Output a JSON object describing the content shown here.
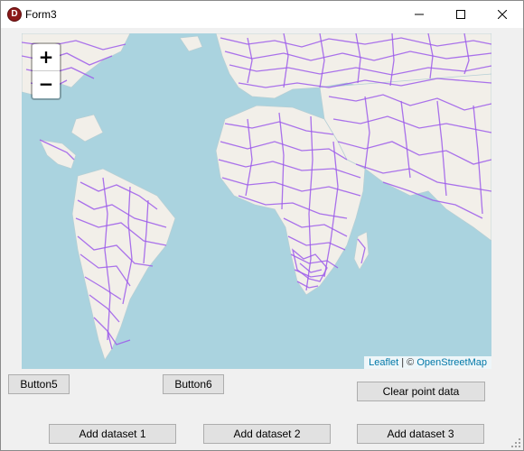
{
  "window": {
    "title": "Form3",
    "icon": "delphi-app-icon",
    "icon_letter": "D",
    "controls": [
      "minimize-icon",
      "maximize-icon",
      "close-icon"
    ]
  },
  "map": {
    "zoom_in_label": "+",
    "zoom_out_label": "−",
    "attribution": {
      "leaflet_link": "Leaflet",
      "separator": " | © ",
      "osm_link": "OpenStreetMap"
    },
    "colors": {
      "ocean": "#aad3df",
      "land": "#f2efe9",
      "boundary": "#9c5bea"
    }
  },
  "buttons": {
    "button5": "Button5",
    "button6": "Button6",
    "clear_point_data": "Clear point data",
    "add_dataset_1": "Add dataset 1",
    "add_dataset_2": "Add dataset 2",
    "add_dataset_3": "Add dataset 3"
  }
}
